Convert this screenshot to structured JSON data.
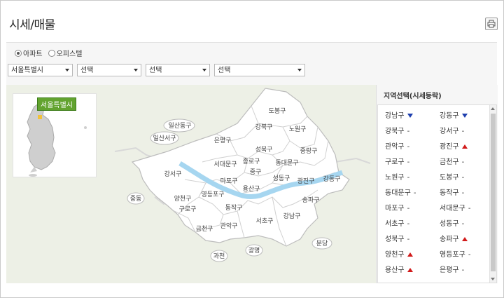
{
  "page": {
    "title": "시세/매물"
  },
  "toolbar": {
    "radios": [
      {
        "label": "아파트",
        "selected": true
      },
      {
        "label": "오피스텔",
        "selected": false
      }
    ],
    "selects": [
      "서울특별시",
      "선택",
      "선택",
      "선택"
    ]
  },
  "map": {
    "inset_label": "서울특별시",
    "districts": [
      "도봉구",
      "강북구",
      "노원구",
      "은평구",
      "성북구",
      "중랑구",
      "서대문구",
      "종로구",
      "동대문구",
      "중구",
      "성동구",
      "광진구",
      "마포구",
      "용산구",
      "강동구",
      "강서구",
      "영등포구",
      "송파구",
      "양천구",
      "동작구",
      "강남구",
      "구로구",
      "서초구",
      "금천구",
      "관악구"
    ],
    "outside": [
      "일산동구",
      "일산서구",
      "중동",
      "분당",
      "과천",
      "광명"
    ]
  },
  "sidebar": {
    "title": "지역선택(시세등락)",
    "items": [
      {
        "name": "강남구",
        "trend": "down"
      },
      {
        "name": "강동구",
        "trend": "down"
      },
      {
        "name": "강북구",
        "trend": "-"
      },
      {
        "name": "강서구",
        "trend": "-"
      },
      {
        "name": "관악구",
        "trend": "-"
      },
      {
        "name": "광진구",
        "trend": "up"
      },
      {
        "name": "구로구",
        "trend": "-"
      },
      {
        "name": "금천구",
        "trend": "-"
      },
      {
        "name": "노원구",
        "trend": "-"
      },
      {
        "name": "도봉구",
        "trend": "-"
      },
      {
        "name": "동대문구",
        "trend": "-"
      },
      {
        "name": "동작구",
        "trend": "-"
      },
      {
        "name": "마포구",
        "trend": "-"
      },
      {
        "name": "서대문구",
        "trend": "-"
      },
      {
        "name": "서초구",
        "trend": "-"
      },
      {
        "name": "성동구",
        "trend": "-"
      },
      {
        "name": "성북구",
        "trend": "-"
      },
      {
        "name": "송파구",
        "trend": "up"
      },
      {
        "name": "양천구",
        "trend": "up"
      },
      {
        "name": "영등포구",
        "trend": "-"
      },
      {
        "name": "용산구",
        "trend": "up"
      },
      {
        "name": "은평구",
        "trend": "-"
      }
    ]
  },
  "icons": {
    "print": "printer-icon",
    "up": "triangle-up-icon",
    "down": "triangle-down-icon"
  },
  "colors": {
    "up": "#d11a1a",
    "down": "#1e3fae",
    "river": "#a6d6f0",
    "inset_label": "#62a32f"
  }
}
